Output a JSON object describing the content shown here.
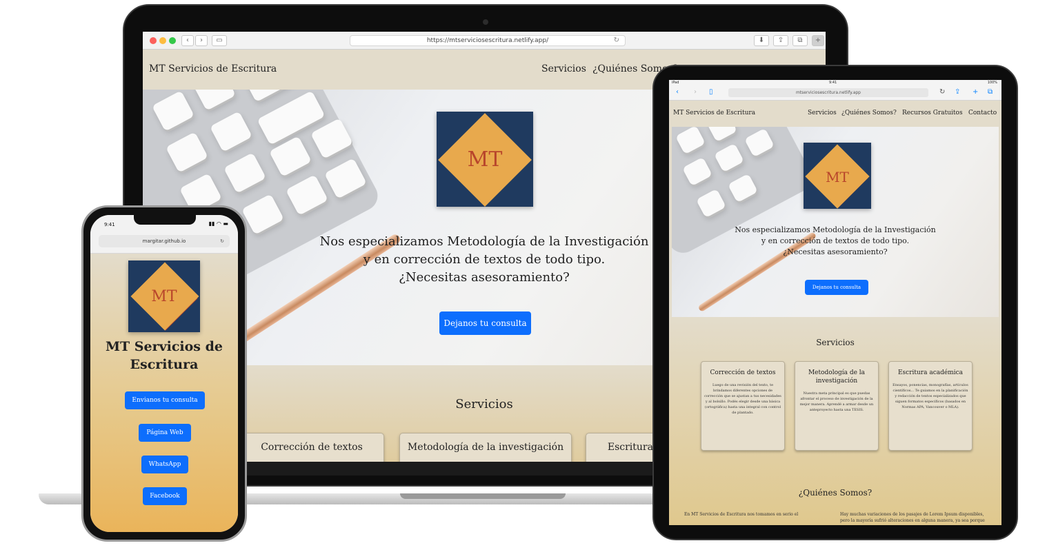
{
  "laptop": {
    "url": "https://mtserviciosescritura.netlify.app/",
    "brand": "MT Servicios de Escritura",
    "nav": [
      "Servicios",
      "¿Quiénes Somos?"
    ],
    "logo_text": "MT",
    "hero_lines": [
      "Nos especializamos Metodología de la Investigación",
      "y en corrección de textos de todo tipo.",
      "¿Necesitas asesoramiento?"
    ],
    "cta": "Dejanos tu consulta",
    "services_title": "Servicios",
    "cards": [
      "Corrección de textos",
      "Metodología de la investigación",
      "Escritura académica"
    ]
  },
  "tablet": {
    "status_left": "iPad",
    "status_time": "9:41",
    "status_right": "100%",
    "url": "mtserviciosescritura.netlify.app",
    "brand": "MT Servicios de Escritura",
    "nav": [
      "Servicios",
      "¿Quiénes Somos?",
      "Recursos Gratuitos",
      "Contacto"
    ],
    "logo_text": "MT",
    "hero_lines": [
      "Nos especializamos Metodología de la Investigación",
      "y en corrección de textos de todo tipo.",
      "¿Necesitas asesoramiento?"
    ],
    "cta": "Dejanos tu consulta",
    "services_title": "Servicios",
    "cards": [
      {
        "title": "Corrección de textos",
        "body": "Luego de una revisión del texto, te brindamos diferentes opciones de corrección que se ajustan a tus necesidades y al bolsillo. Podés elegir desde una básica (ortográfica) hasta una integral con control de plantado."
      },
      {
        "title": "Metodología de la investigación",
        "body": "Nuestra meta principal es que puedas afrontar el proceso de investigación de la mejor manera. Aprendé a armar desde un anteproyecto hasta una TESIS."
      },
      {
        "title": "Escritura académica",
        "body": "Ensayos, ponencias, monografías, artículos científicos... Te guiamos en la planificación y redacción de textos especializados que siguen formatos específicos (basados en Normas APA, Vancouver o MLA)."
      }
    ],
    "quienes_title": "¿Quiénes Somos?",
    "col_left": "En MT Servicios de Escritura nos tomamos en serio el",
    "col_right": "Hay muchas variaciones de los pasajes de Lorem Ipsum disponibles, pero la mayoría sufrió alteraciones en alguna manera, ya sea porque"
  },
  "phone": {
    "status_time": "9:41",
    "url": "margitar.github.io",
    "logo_text": "MT",
    "title": "MT Servicios de Escritura",
    "buttons": [
      "Envianos tu consulta",
      "Página Web",
      "WhatsApp",
      "Facebook"
    ]
  },
  "colors": {
    "page_bg": "#e3dccb",
    "logo_bg": "#1f3a5f",
    "logo_diamond": "#e8a94d",
    "logo_text": "#b8452b",
    "button": "#0d6efd"
  }
}
